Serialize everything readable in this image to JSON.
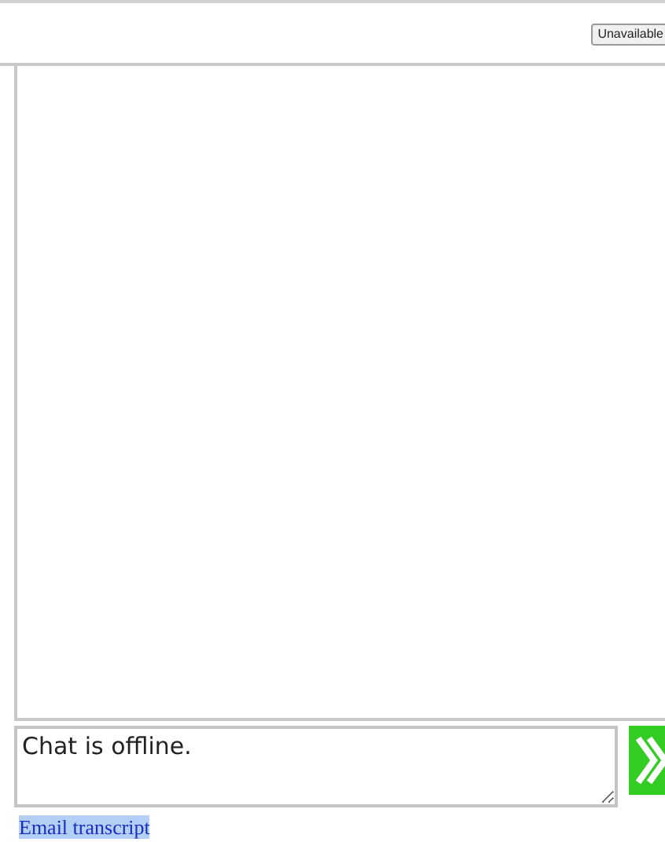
{
  "header": {
    "status_button": "Unavailable"
  },
  "composer": {
    "value": "Chat is offline."
  },
  "email_link": "Email transcript"
}
